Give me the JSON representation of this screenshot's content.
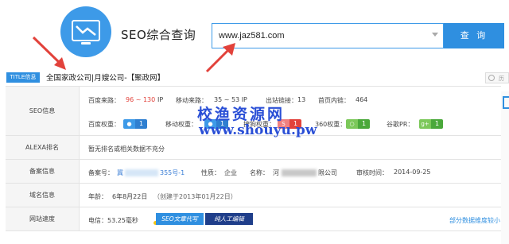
{
  "app": {
    "title": "SEO综合查询"
  },
  "search": {
    "value": "www.jaz581.com",
    "button_label": "查 询"
  },
  "title_bar": {
    "badge": "TITLE信息",
    "title": "全国家政公司|月嫂公司-【聚政网】",
    "history_label": "历"
  },
  "seo_row": {
    "label": "SEO信息",
    "baidu_source_label": "百度来路：",
    "baidu_source_value": "96 ~ 130",
    "baidu_source_unit": "IP",
    "mobile_source_label": "移动来路：",
    "mobile_source_value": "35 ~ 53 IP",
    "outbound_label": "出站链接：",
    "outbound_value": "13",
    "homepage_links_label": "首页内链：",
    "homepage_links_value": "464",
    "baidu_weight_label": "百度权重：",
    "baidu_weight_value": "1",
    "mobile_weight_label": "移动权重：",
    "mobile_weight_value": "1",
    "sogou_label": "搜狗权重：",
    "sogou_value": "1",
    "so360_label": "360权重：",
    "so360_value": "1",
    "google_label": "谷歌PR：",
    "google_value": "1"
  },
  "alexa_row": {
    "label": "ALEXA排名",
    "value": "暂无排名或相关数据不充分"
  },
  "beian_row": {
    "label": "备案信息",
    "record_label": "备案号：",
    "record_value_start": "冀",
    "record_value_end": "355号-1",
    "nature_label": "性质：",
    "nature_value": "企业",
    "name_label": "名称：",
    "name_value_start": "河",
    "name_value_end": "限公司",
    "audit_label": "审核时间：",
    "audit_value": "2014-09-25"
  },
  "domain_row": {
    "label": "域名信息",
    "age_label": "年龄：",
    "age_value": "6年8月22日",
    "created": "（创建于2013年01月22日）"
  },
  "speed_row": {
    "label": "网站速度",
    "telecom": "电信：53.25毫秒",
    "tag_seo": "SEO文章代写",
    "tag_manual": "纯人工编辑",
    "note": "部分数据维度较小"
  },
  "watermark": {
    "cn": "校渔资源网",
    "url": "www.shouyu.pw"
  },
  "colors": {
    "accent": "#2f8fe0",
    "red": "#e2423b",
    "watermark": "#2a4fd6",
    "annotation_arrow": "#e2423b"
  },
  "icons": [
    "monitor-chart-icon",
    "dropdown-caret-icon",
    "history-clock-icon",
    "paw-icon",
    "sogou-icon",
    "so360-icon",
    "google-plus-icon",
    "annotation-arrow-icon"
  ]
}
